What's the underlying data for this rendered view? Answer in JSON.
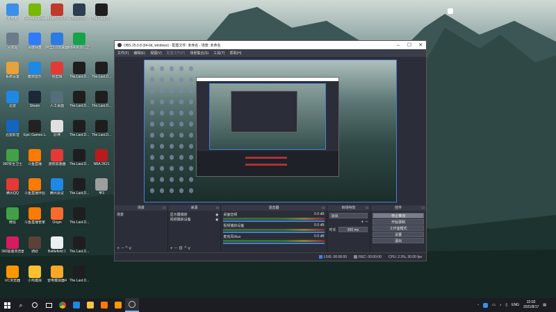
{
  "desktop": {
    "icons": [
      {
        "label": "此电脑",
        "color": "#3b8fe8"
      },
      {
        "label": "GeForce Experience",
        "color": "#76b900"
      },
      {
        "label": "MorphVOX Pro",
        "color": "#c0392b"
      },
      {
        "label": "CBA2020-...",
        "color": "#2c3e50"
      },
      {
        "label": "The.Last.D...",
        "color": "#1e1e1e"
      },
      {
        "label": "回收站",
        "color": "#6b7b8c"
      },
      {
        "label": "百度网盘",
        "color": "#2e7bff"
      },
      {
        "label": "阿里1.0加速器",
        "color": "#2c7be5"
      },
      {
        "label": "NBA2K20...之增强版",
        "color": "#16a34a"
      },
      {
        "label": "",
        "color": ""
      },
      {
        "label": "系统设置",
        "color": "#e6a23c"
      },
      {
        "label": "酷狗音乐",
        "color": "#1e88e5"
      },
      {
        "label": "快剪辑",
        "color": "#e53935"
      },
      {
        "label": "The.Last.D...",
        "color": "#1e1e1e"
      },
      {
        "label": "The.Last.D...",
        "color": "#1e1e1e"
      },
      {
        "label": "迅雷",
        "color": "#1e88e5"
      },
      {
        "label": "Steam",
        "color": "#1b2838"
      },
      {
        "label": "人工桌面",
        "color": "#546e7a"
      },
      {
        "label": "The.Last.D...",
        "color": "#1e1e1e"
      },
      {
        "label": "The.Last.D...",
        "color": "#1e1e1e"
      },
      {
        "label": "迅雷影音",
        "color": "#1565c0"
      },
      {
        "label": "Epic Games Launcher",
        "color": "#222"
      },
      {
        "label": "原神",
        "color": "#e0e0e0"
      },
      {
        "label": "The.Last.D...",
        "color": "#1e1e1e"
      },
      {
        "label": "The.Last.D...",
        "color": "#1e1e1e"
      },
      {
        "label": "360安全卫士",
        "color": "#43a047"
      },
      {
        "label": "斗鱼直播",
        "color": "#ff7a00"
      },
      {
        "label": "游侠加速器",
        "color": "#e53935"
      },
      {
        "label": "The.Last.D...",
        "color": "#1e1e1e"
      },
      {
        "label": "NBA 2K21",
        "color": "#b71c1c"
      },
      {
        "label": "腾讯QQ",
        "color": "#e53935"
      },
      {
        "label": "斗鱼直播伴侣",
        "color": "#ff7a00"
      },
      {
        "label": "腾讯会议",
        "color": "#1e88e5"
      },
      {
        "label": "The.Last.D...",
        "color": "#1e1e1e"
      },
      {
        "label": "苹3",
        "color": "#9e9e9e"
      },
      {
        "label": "微信",
        "color": "#43a047"
      },
      {
        "label": "斗鱼直播管家",
        "color": "#ff7a00"
      },
      {
        "label": "Origin",
        "color": "#f56c2d"
      },
      {
        "label": "The.Last.D...",
        "color": "#1e1e1e"
      },
      {
        "label": "",
        "color": ""
      },
      {
        "label": "360极速浏览器",
        "color": "#d81b60"
      },
      {
        "label": "骑砍",
        "color": "#5d4037"
      },
      {
        "label": "Battlefield 1",
        "color": "#eceff1"
      },
      {
        "label": "The.Last.D...",
        "color": "#1e1e1e"
      },
      {
        "label": "",
        "color": ""
      },
      {
        "label": "UC浏览器",
        "color": "#ff9800"
      },
      {
        "label": "小鸡模拟",
        "color": "#fbc02d"
      },
      {
        "label": "雷电模拟器4",
        "color": "#f9a825"
      },
      {
        "label": "The.Last.D...",
        "color": "#1e1e1e"
      },
      {
        "label": "",
        "color": ""
      }
    ]
  },
  "obs": {
    "title": "OBS 25.0.8 (64-bit, windows) - 配置文件: 未命名 - 场景: 未命名",
    "menu": [
      "文件(F)",
      "编辑(E)",
      "视图(V)",
      "配置文件(P)",
      "场景集合(S)",
      "工具(T)",
      "帮助(H)"
    ],
    "docks": {
      "scenes": {
        "title": "场景",
        "items": [
          "场景"
        ]
      },
      "sources": {
        "title": "来源",
        "items": [
          "显示器捕获",
          "视频捕获设备"
        ]
      },
      "mixer": {
        "title": "混音器",
        "channels": [
          {
            "name": "桌面音频",
            "db": "0.0 dB"
          },
          {
            "name": "视频捕获设备",
            "db": "0.0 dB"
          },
          {
            "name": "麦克风/Aux",
            "db": "0.0 dB"
          }
        ]
      },
      "transitions": {
        "title": "转场特效",
        "type": "淡出",
        "duration_label": "时长",
        "duration": "300 ms"
      },
      "controls": {
        "title": "控件",
        "buttons": [
          "停止推流",
          "开始录制",
          "工作室模式",
          "设置",
          "退出"
        ]
      }
    },
    "status": {
      "live": "LIVE: 00:00:00",
      "rec": "REC: 00:00:00",
      "cpu": "CPU: 2.3%, 30.00 fps"
    }
  },
  "taskbar": {
    "lang": "ENG",
    "time": "22:02",
    "date": "2021/8/17"
  }
}
